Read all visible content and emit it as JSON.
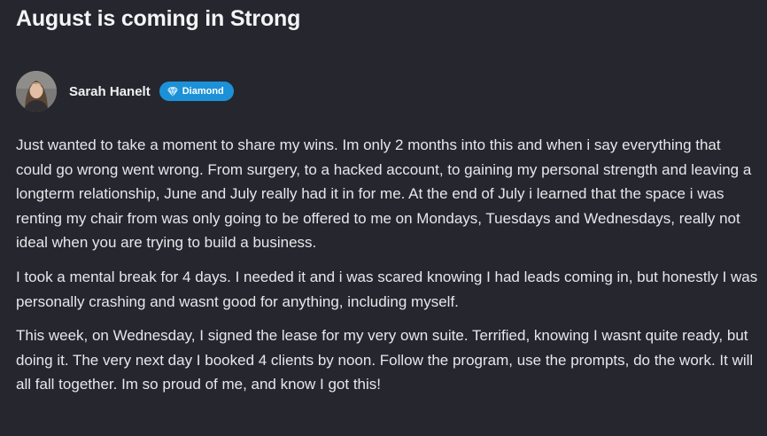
{
  "post": {
    "title": "August is coming in Strong",
    "author": {
      "name": "Sarah Hanelt",
      "avatar_icon": "user-photo",
      "badge": {
        "icon": "diamond-icon",
        "label": "Diamond",
        "color": "#1c91d8"
      }
    },
    "paragraphs": [
      "Just wanted to take a moment to share my wins. Im only 2 months into this and when i say everything that could go wrong went wrong. From surgery, to a hacked account, to gaining my personal strength and leaving a longterm relationship, June and July really had it in for me. At the end of July i learned that the space i was renting my chair from was only going to be offered to me on Mondays, Tuesdays and Wednesdays, really not ideal when you are trying to build a business.",
      "I took a mental break for 4 days. I needed it and i was scared knowing I had leads coming in, but honestly I was personally crashing and wasnt good for anything, including myself.",
      "This week, on Wednesday, I signed the lease for my very own suite. Terrified, knowing I wasnt quite ready, but doing it. The very next day I booked 4 clients by noon. Follow the program, use the prompts, do the work. It will all fall together. Im so proud of me, and know I got this!"
    ]
  },
  "theme": {
    "background": "#26262e",
    "text": "#e6e6eb",
    "badge": "#1c91d8"
  }
}
